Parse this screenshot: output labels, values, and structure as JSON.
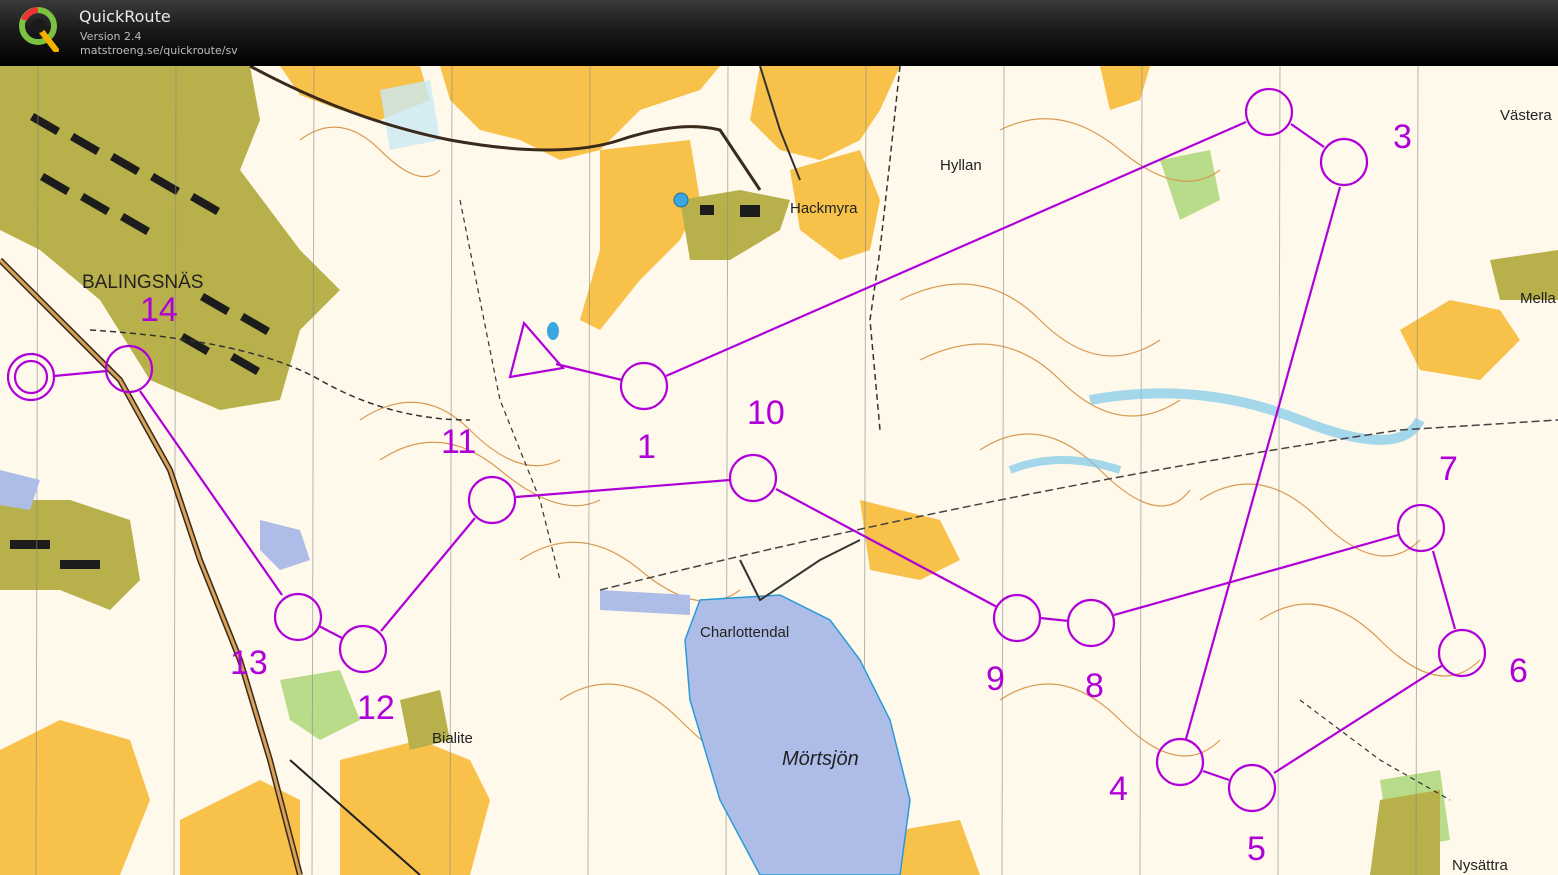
{
  "app": {
    "title": "QuickRoute",
    "version": "Version 2.4",
    "url": "matstroeng.se/quickroute/sv"
  },
  "colors": {
    "course": "#b000d8",
    "field": "#f7c14a",
    "settlement": "#b8b04a",
    "water": "#aebde8",
    "contour": "#d99a52",
    "forest": "#fff9ec",
    "green": "#b9dc8a"
  },
  "map": {
    "place_names": {
      "balingsnas": "BALINGSNÄS",
      "hackmyra": "Hackmyra",
      "hyllan": "Hyllan",
      "charlottendal": "Charlottendal",
      "mortsjon": "Mörtsjön",
      "bialite": "Bialite",
      "vastera": "Västera",
      "mella": "Mella",
      "nysattra": "Nysättra"
    },
    "controls": {
      "c1": "1",
      "c3": "3",
      "c4": "4",
      "c5": "5",
      "c6": "6",
      "c7": "7",
      "c8": "8",
      "c9": "9",
      "c10": "10",
      "c11": "11",
      "c12": "12",
      "c13": "13",
      "c14": "14"
    }
  }
}
